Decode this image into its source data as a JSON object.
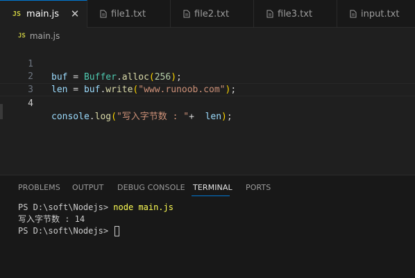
{
  "tabs": [
    {
      "label": "main.js",
      "icon": "js-icon",
      "badge": "JS",
      "active": true,
      "close": "✕"
    },
    {
      "label": "file1.txt",
      "icon": "file-icon",
      "active": false
    },
    {
      "label": "file2.txt",
      "icon": "file-icon",
      "active": false
    },
    {
      "label": "file3.txt",
      "icon": "file-icon",
      "active": false
    },
    {
      "label": "input.txt",
      "icon": "file-icon",
      "active": false
    }
  ],
  "breadcrumb": {
    "badge": "JS",
    "file": "main.js"
  },
  "editor": {
    "line_numbers": [
      "1",
      "2",
      "3",
      "4"
    ],
    "active_line": 4,
    "lines": [
      [
        {
          "t": "buf",
          "c": "var"
        },
        {
          "t": " = ",
          "c": "op"
        },
        {
          "t": "Buffer",
          "c": "cls"
        },
        {
          "t": ".",
          "c": "punc"
        },
        {
          "t": "alloc",
          "c": "fn"
        },
        {
          "t": "(",
          "c": "paren"
        },
        {
          "t": "256",
          "c": "num"
        },
        {
          "t": ")",
          "c": "paren"
        },
        {
          "t": ";",
          "c": "punc"
        }
      ],
      [
        {
          "t": "len",
          "c": "var"
        },
        {
          "t": " = ",
          "c": "op"
        },
        {
          "t": "buf",
          "c": "var"
        },
        {
          "t": ".",
          "c": "punc"
        },
        {
          "t": "write",
          "c": "fn"
        },
        {
          "t": "(",
          "c": "paren"
        },
        {
          "t": "\"www.runoob.com\"",
          "c": "str"
        },
        {
          "t": ")",
          "c": "paren"
        },
        {
          "t": ";",
          "c": "punc"
        }
      ],
      [],
      [
        {
          "t": "console",
          "c": "var"
        },
        {
          "t": ".",
          "c": "punc"
        },
        {
          "t": "log",
          "c": "fn"
        },
        {
          "t": "(",
          "c": "paren"
        },
        {
          "t": "\"写入字节数 : \"",
          "c": "str"
        },
        {
          "t": "+  ",
          "c": "op"
        },
        {
          "t": "len",
          "c": "var"
        },
        {
          "t": ")",
          "c": "paren"
        },
        {
          "t": ";",
          "c": "punc"
        }
      ]
    ]
  },
  "panel": {
    "tabs": [
      "PROBLEMS",
      "OUTPUT",
      "DEBUG CONSOLE",
      "TERMINAL",
      "PORTS"
    ],
    "active_tab": "TERMINAL"
  },
  "terminal": {
    "prompt1": "PS D:\\soft\\Nodejs> ",
    "command1": "node main.js",
    "output1": "写入字节数 : 14",
    "prompt2": "PS D:\\soft\\Nodejs> "
  },
  "colors": {
    "accent": "#0078d4",
    "js_badge": "#cbcb41",
    "terminal_command": "#ffff55"
  }
}
